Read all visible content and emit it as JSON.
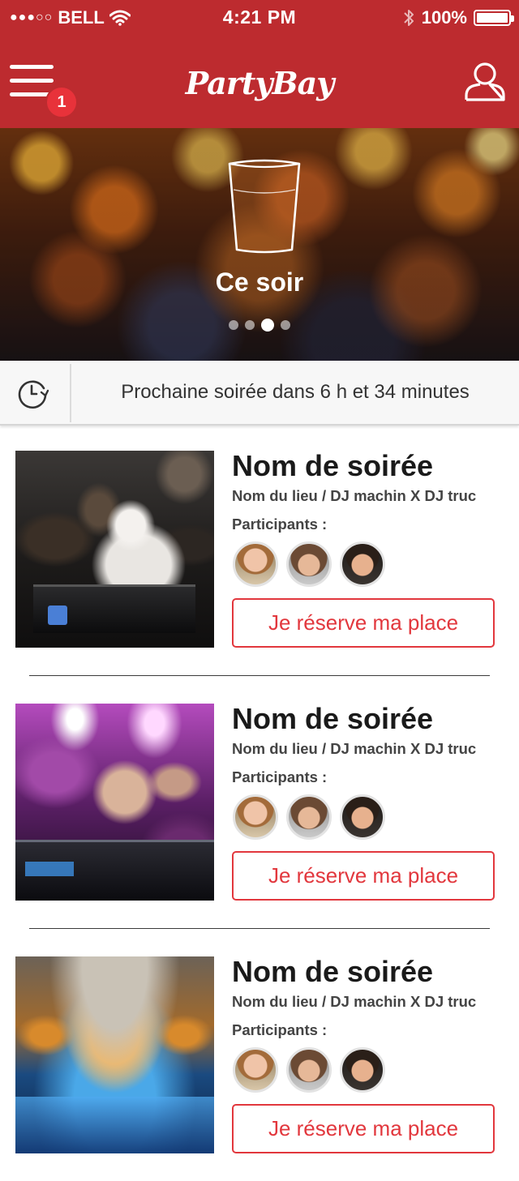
{
  "status_bar": {
    "signal": "●●●○○",
    "carrier": "BELL",
    "time": "4:21 PM",
    "battery": "100%",
    "battery_level": 1.0
  },
  "navbar": {
    "logo": "PartyBay",
    "menu_badge": "1",
    "icons": {
      "menu": "hamburger-menu-icon",
      "profile": "user-profile-icon"
    }
  },
  "hero": {
    "title": "Ce soir",
    "icon": "cup-icon",
    "pagination": {
      "count": 4,
      "active_index": 2
    }
  },
  "countdown": {
    "icon": "clock-icon",
    "text": "Prochaine soirée dans 6 h et 34 minutes"
  },
  "events": [
    {
      "name": "Nom de soirée",
      "venue": "Nom du lieu / DJ machin X DJ truc",
      "participants_label": "Participants :",
      "button": "Je réserve ma place"
    },
    {
      "name": "Nom de soirée",
      "venue": "Nom du lieu / DJ machin X DJ truc",
      "participants_label": "Participants :",
      "button": "Je réserve ma place"
    },
    {
      "name": "Nom de soirée",
      "venue": "Nom du lieu / DJ machin X DJ truc",
      "participants_label": "Participants :",
      "button": "Je réserve ma place"
    }
  ],
  "colors": {
    "brand_red": "#bd2b2f",
    "accent_red": "#e2373d",
    "badge_red": "#e8323a"
  }
}
